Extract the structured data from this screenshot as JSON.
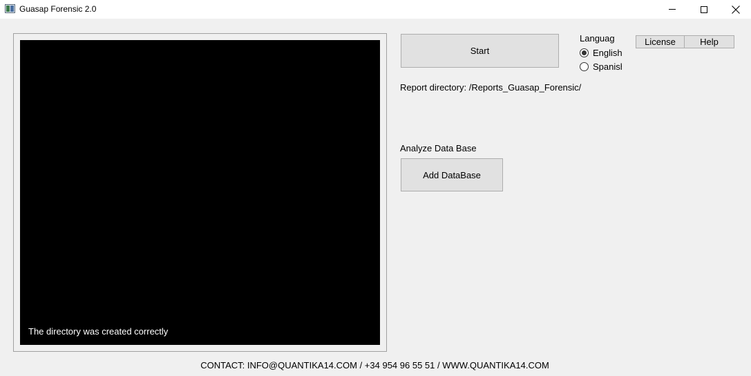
{
  "window": {
    "title": "Guasap Forensic 2.0",
    "icon": "app-icon",
    "controls": [
      "minimize-icon",
      "maximize-icon",
      "close-icon"
    ]
  },
  "console": {
    "background": "#000000",
    "text_color": "#ffffff",
    "message": "The directory was created correctly"
  },
  "actions": {
    "start_label": "Start",
    "license_label": "License",
    "help_label": "Help"
  },
  "language": {
    "title": "Languag",
    "options": [
      {
        "label": "English",
        "selected": true
      },
      {
        "label": "Spanish",
        "selected": false
      }
    ]
  },
  "report": {
    "text": "Report directory: /Reports_Guasap_Forensic/"
  },
  "database": {
    "section_label": "Analyze Data Base",
    "add_label": "Add DataBase"
  },
  "footer": {
    "contact": "CONTACT: INFO@QUANTIKA14.COM / +34 954 96 55 51 / WWW.QUANTIKA14.COM"
  }
}
